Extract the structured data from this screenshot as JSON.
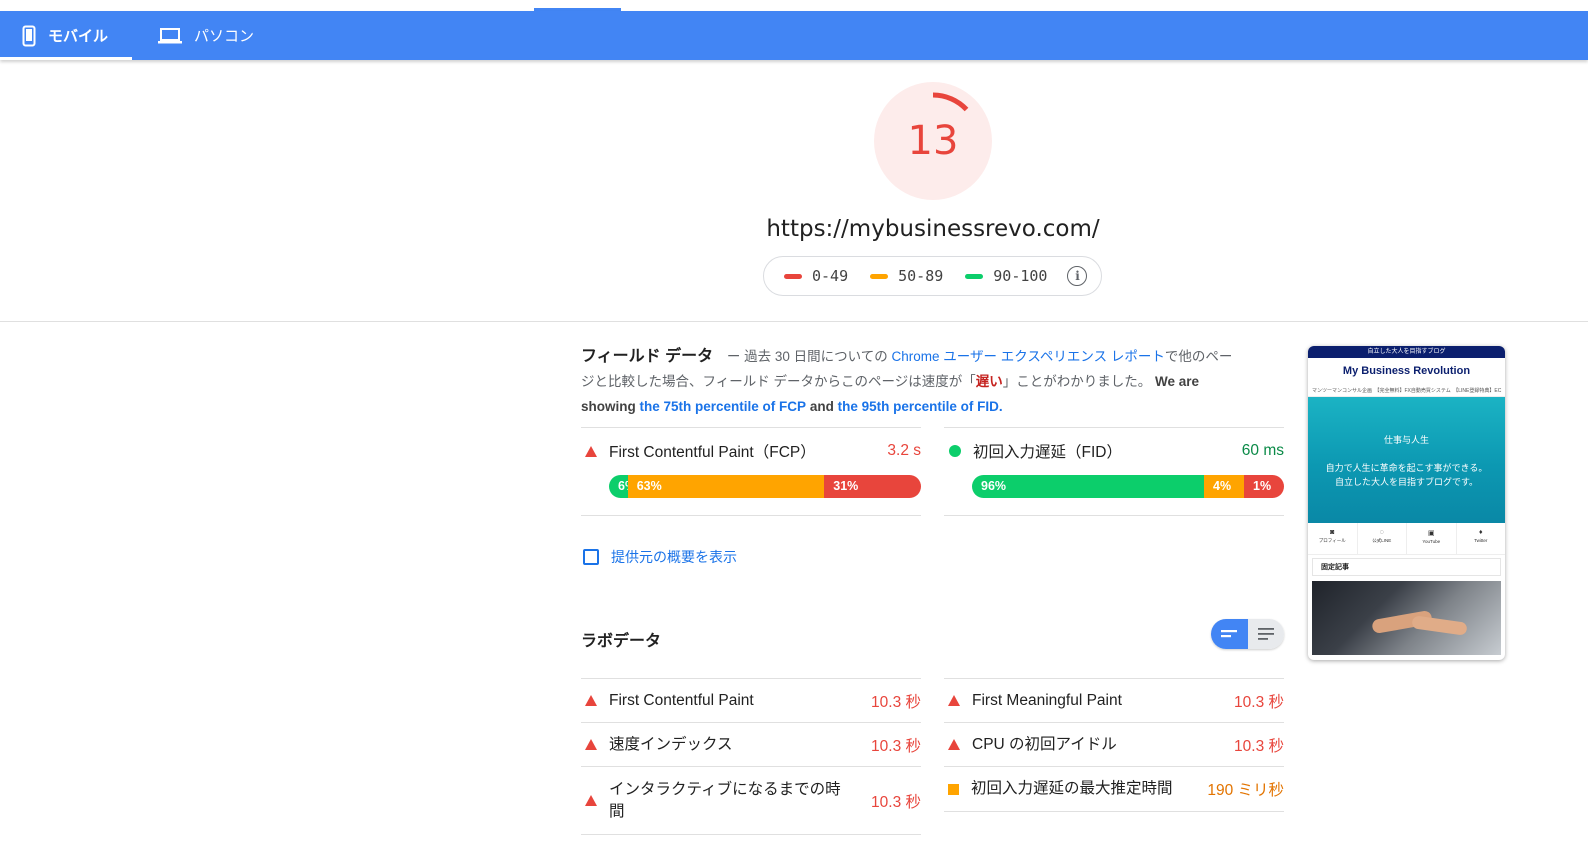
{
  "tabs": [
    {
      "label": "モバイル",
      "icon": "smartphone-icon",
      "active": true
    },
    {
      "label": "パソコン",
      "icon": "laptop-icon",
      "active": false
    }
  ],
  "score": {
    "value": "13",
    "color": "#e8453c"
  },
  "url": "https://mybusinessrevo.com/",
  "legend": {
    "items": [
      {
        "range": "0-49",
        "color": "#e8453c"
      },
      {
        "range": "50-89",
        "color": "#ffa400"
      },
      {
        "range": "90-100",
        "color": "#0cce6b"
      }
    ],
    "info_icon": "info-icon"
  },
  "field": {
    "title": "フィールド データ",
    "desc_prefix": " ー 過去 30 日間についての ",
    "report_link": "Chrome ユーザー エクスペリエンス レポート",
    "desc_mid": "で他のページと比較した場合、フィールド データからこのページは速度が「",
    "speed_word": "遅い",
    "desc_suffix": "」ことがわかりました。 ",
    "we_are": "We are",
    "showing": "showing",
    "fcp_link": "the 75th percentile of FCP",
    "and": "and",
    "fid_link": "the 95th percentile of FID.",
    "metrics": [
      {
        "label": "First Contentful Paint（FCP）",
        "value": "3.2 s",
        "status": "slow",
        "dist": [
          {
            "pct": 6,
            "label": "6%",
            "color": "#0cce6b"
          },
          {
            "pct": 63,
            "label": "63%",
            "color": "#ffa400"
          },
          {
            "pct": 31,
            "label": "31%",
            "color": "#e8453c"
          }
        ]
      },
      {
        "label": "初回入力遅延（FID）",
        "value": "60 ms",
        "status": "fast",
        "dist": [
          {
            "pct": 96,
            "label": "96%",
            "color": "#0cce6b"
          },
          {
            "pct": 4,
            "label": "4%",
            "color": "#ffa400"
          },
          {
            "pct": 1,
            "label": "1%",
            "color": "#e8453c"
          }
        ]
      }
    ],
    "origin_toggle": "提供元の概要を表示"
  },
  "lab": {
    "title": "ラボデータ",
    "left": [
      {
        "label": "First Contentful Paint",
        "value": "10.3 秒",
        "status": "slow"
      },
      {
        "label": "速度インデックス",
        "value": "10.3 秒",
        "status": "slow"
      },
      {
        "label": "インタラクティブになるまでの時間",
        "value": "10.3 秒",
        "status": "slow"
      }
    ],
    "right": [
      {
        "label": "First Meaningful Paint",
        "value": "10.3 秒",
        "status": "slow"
      },
      {
        "label": "CPU の初回アイドル",
        "value": "10.3 秒",
        "status": "slow"
      },
      {
        "label": "初回入力遅延の最大推定時間",
        "value": "190 ミリ秒",
        "status": "average"
      }
    ]
  },
  "thumbnail": {
    "top_bar": "自立した大人を目指すブログ",
    "brand": "My Business Revolution",
    "nav": "マンツーマンコンサル企画　【完全無料】FX自動売買システム　【LINE登録特典】EC",
    "hero_title": "仕事与人生",
    "hero_line1": "自力で人生に革命を起こす事ができる。",
    "hero_line2": "自立した大人を目指すブログです。",
    "icons": [
      "プロフィール",
      "公式LINE",
      "YouTube",
      "Twitter"
    ],
    "fixed": "固定記事"
  }
}
